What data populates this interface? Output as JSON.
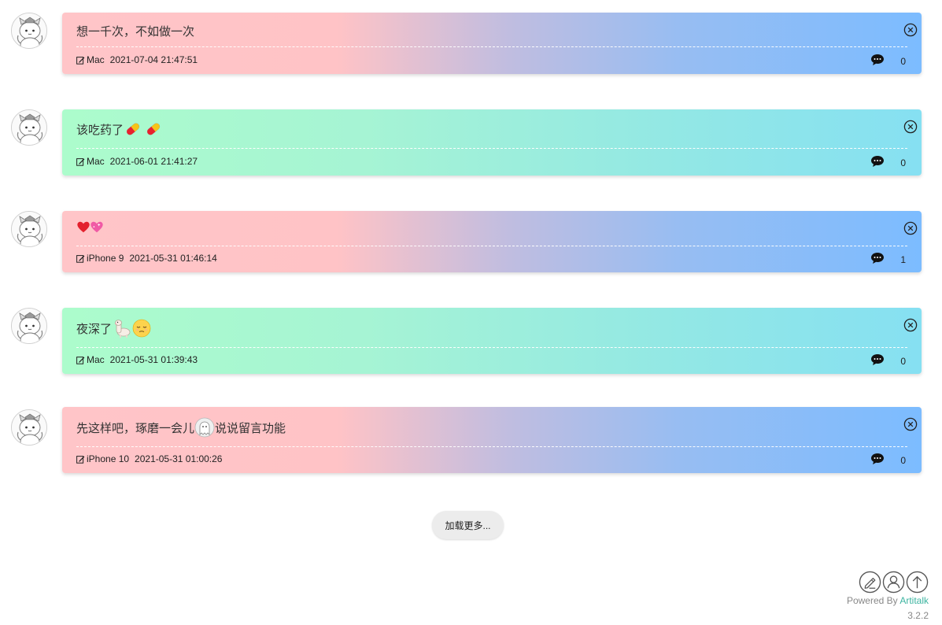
{
  "posts": [
    {
      "text": "想一千次，不如做一次",
      "emojis": [],
      "after_text": "",
      "device": "Mac",
      "date": "2021-07-04 21:47:51",
      "comments": "0",
      "style": "pink"
    },
    {
      "text": "该吃药了",
      "emojis": [
        "pill",
        "pill"
      ],
      "after_text": "",
      "device": "Mac",
      "date": "2021-06-01 21:41:27",
      "comments": "0",
      "style": "green"
    },
    {
      "text": "",
      "emojis": [
        "red-heart",
        "sparkling-heart"
      ],
      "after_text": "",
      "device": "iPhone 9",
      "date": "2021-05-31 01:46:14",
      "comments": "1",
      "style": "pink"
    },
    {
      "text": "夜深了",
      "emojis": [
        "alpaca",
        "sleepy-face"
      ],
      "after_text": "",
      "device": "Mac",
      "date": "2021-05-31 01:39:43",
      "comments": "0",
      "style": "green"
    },
    {
      "text": "先这样吧，琢磨一会儿",
      "emojis": [
        "ghost"
      ],
      "after_text": "说说留言功能",
      "device": "iPhone 10",
      "date": "2021-05-31 01:00:26",
      "comments": "0",
      "style": "pink"
    }
  ],
  "load_more_label": "加载更多...",
  "footer": {
    "powered_prefix": "Powered By ",
    "powered_brand": "Artitalk",
    "version": "3.2.2"
  },
  "toolbar_icons": [
    "edit-icon",
    "user-icon",
    "arrow-up-icon"
  ],
  "colors": {
    "pink_start": "#ffc5c8",
    "blue_end": "#7cbcff",
    "green_start": "#acfccc",
    "cyan_end": "#86e0f2",
    "brand": "#3cb4a0"
  }
}
